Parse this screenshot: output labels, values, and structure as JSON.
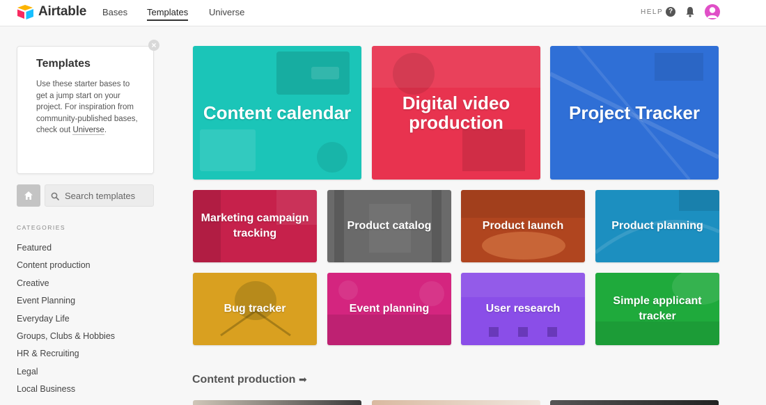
{
  "app": {
    "name": "Airtable",
    "brand_colors": {
      "yellow": "#fcb400",
      "red": "#f82b60",
      "blue": "#18bfff",
      "teal": "#2d7ff9"
    }
  },
  "nav": {
    "links": [
      {
        "label": "Bases",
        "active": false
      },
      {
        "label": "Templates",
        "active": true
      },
      {
        "label": "Universe",
        "active": false
      }
    ],
    "help_label": "HELP",
    "icons": [
      "help-icon",
      "bell-icon",
      "avatar"
    ]
  },
  "sidebar": {
    "intro": {
      "title": "Templates",
      "text": "Use these starter bases to get a jump start on your project. For inspiration from community-published bases, check out",
      "link": "Universe",
      "suffix": "."
    },
    "search": {
      "placeholder": "Search templates"
    },
    "categories_heading": "CATEGORIES",
    "categories": [
      "Featured",
      "Content production",
      "Creative",
      "Event Planning",
      "Everyday Life",
      "Groups, Clubs & Hobbies",
      "HR & Recruiting",
      "Legal",
      "Local Business"
    ]
  },
  "featured": {
    "big": [
      {
        "title": "Content calendar",
        "color": "#1bc5b8"
      },
      {
        "title": "Digital video production",
        "color": "#e8334f"
      },
      {
        "title": "Project Tracker",
        "color": "#2f6fd6"
      }
    ],
    "small": [
      {
        "title": "Marketing campaign tracking",
        "color": "#c6214b"
      },
      {
        "title": "Product catalog",
        "color": "#6a6a6a"
      },
      {
        "title": "Product launch",
        "color": "#b0451f"
      },
      {
        "title": "Product planning",
        "color": "#1c8fc0"
      },
      {
        "title": "Bug tracker",
        "color": "#d9a020"
      },
      {
        "title": "Event planning",
        "color": "#d4257f"
      },
      {
        "title": "User research",
        "color": "#8a4ee8"
      },
      {
        "title": "Simple applicant tracker",
        "color": "#1faa3c"
      }
    ]
  },
  "section": {
    "title": "Content production",
    "arrow": "➡"
  }
}
